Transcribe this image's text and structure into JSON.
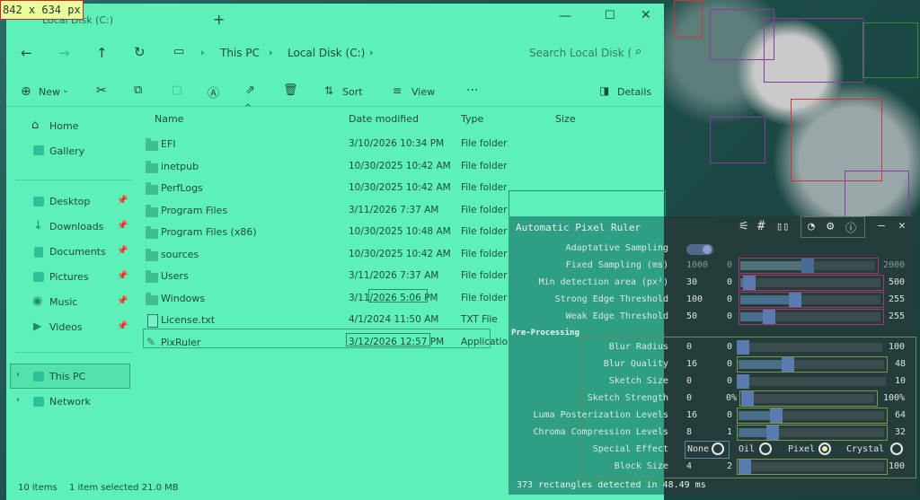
{
  "size_label": "842 x 634 px",
  "explorer": {
    "tab_title": "Local Disk (C:)",
    "new_tab": "+",
    "breadcrumb": [
      "This PC",
      "Local Disk (C:)"
    ],
    "search_placeholder": "Search Local Disk (",
    "toolbar": {
      "new": "New",
      "sort": "Sort",
      "view": "View",
      "more": "···",
      "details": "Details"
    },
    "columns": {
      "name": "Name",
      "date": "Date modified",
      "type": "Type",
      "size": "Size"
    },
    "nav": {
      "home": "Home",
      "gallery": "Gallery",
      "desktop": "Desktop",
      "downloads": "Downloads",
      "documents": "Documents",
      "pictures": "Pictures",
      "music": "Music",
      "videos": "Videos",
      "this_pc": "This PC",
      "network": "Network"
    },
    "files": [
      {
        "name": "EFI",
        "date": "3/10/2026 10:34 PM",
        "type": "File folder"
      },
      {
        "name": "inetpub",
        "date": "10/30/2025 10:42 AM",
        "type": "File folder"
      },
      {
        "name": "PerfLogs",
        "date": "10/30/2025 10:42 AM",
        "type": "File folder"
      },
      {
        "name": "Program Files",
        "date": "3/11/2026 7:37 AM",
        "type": "File folder"
      },
      {
        "name": "Program Files (x86)",
        "date": "10/30/2025 10:48 AM",
        "type": "File folder"
      },
      {
        "name": "sources",
        "date": "10/30/2025 10:42 AM",
        "type": "File folder"
      },
      {
        "name": "Users",
        "date": "3/11/2026 7:37 AM",
        "type": "File folder"
      },
      {
        "name": "Windows",
        "date": "3/11/2026 5:06 PM",
        "type": "File folder"
      },
      {
        "name": "License.txt",
        "date": "4/1/2024 11:50 AM",
        "type": "TXT File"
      },
      {
        "name": "PixRuler",
        "date": "3/12/2026 12:57 PM",
        "type": "Application"
      }
    ],
    "status": {
      "items": "10 items",
      "selected": "1 item selected  21.0 MB"
    }
  },
  "ruler": {
    "title": "Automatic Pixel Ruler",
    "controls": {
      "adaptive": "Adaptative Sampling",
      "fixed": "Fixed Sampling (ms)",
      "fixed_val": "1000",
      "fixed_min": "0",
      "fixed_max": "2000",
      "min_area": "Min detection area (px²)",
      "min_area_val": "30",
      "min_area_min": "0",
      "min_area_max": "500",
      "strong": "Strong Edge Threshold",
      "strong_val": "100",
      "strong_min": "0",
      "strong_max": "255",
      "weak": "Weak Edge Threshold",
      "weak_val": "50",
      "weak_min": "0",
      "weak_max": "255"
    },
    "preprocessing": {
      "header": "Pre-Processing",
      "blur_radius": "Blur Radius",
      "blur_radius_val": "0",
      "blur_radius_min": "0",
      "blur_radius_max": "100",
      "blur_quality": "Blur Quality",
      "blur_quality_val": "16",
      "blur_quality_min": "0",
      "blur_quality_max": "48",
      "sketch_size": "Sketch Size",
      "sketch_size_val": "0",
      "sketch_size_min": "0",
      "sketch_size_max": "10",
      "sketch_strength": "Sketch Strength",
      "sketch_strength_val": "0",
      "sketch_strength_min": "0%",
      "sketch_strength_max": "100%",
      "luma": "Luma Posterization Levels",
      "luma_val": "16",
      "luma_min": "0",
      "luma_max": "64",
      "chroma": "Chroma Compression Levels",
      "chroma_val": "8",
      "chroma_min": "1",
      "chroma_max": "32",
      "special": "Special Effect",
      "effects": [
        "None",
        "Oil",
        "Pixel",
        "Crystal"
      ],
      "effect_selected": "Pixel",
      "block": "Block Size",
      "block_val": "4",
      "block_min": "2",
      "block_max": "100"
    },
    "status": "373 rectangles detected in 48.49 ms"
  }
}
